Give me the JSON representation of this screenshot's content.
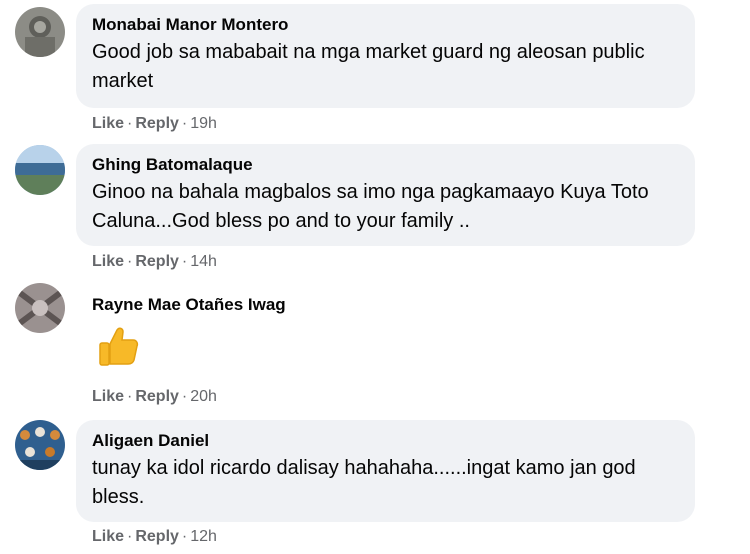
{
  "comments": [
    {
      "author": "Monabai Manor Montero",
      "text": "Good job sa mababait na mga market guard ng aleosan public market",
      "like_label": "Like",
      "reply_label": "Reply",
      "dot": "·",
      "time": "19h",
      "avatar_color": "#6f6f6a"
    },
    {
      "author": "Ghing Batomalaque",
      "text": "Ginoo na bahala magbalos sa imo nga pagkamaayo Kuya Toto Caluna...God bless po and to your family ..",
      "like_label": "Like",
      "reply_label": "Reply",
      "dot": "·",
      "time": "14h",
      "avatar_color": "#4f7fa8"
    },
    {
      "author": "Rayne Mae Otañes Iwag",
      "text": "",
      "emoji": "thumbs-up",
      "like_label": "Like",
      "reply_label": "Reply",
      "dot": "·",
      "time": "20h",
      "avatar_color": "#8a8180"
    },
    {
      "author": "Aligaen Daniel",
      "text": "tunay ka idol ricardo dalisay hahahaha......ingat kamo jan god bless.",
      "like_label": "Like",
      "reply_label": "Reply",
      "dot": "·",
      "time": "12h",
      "avatar_color": "#3c6fa0"
    }
  ]
}
